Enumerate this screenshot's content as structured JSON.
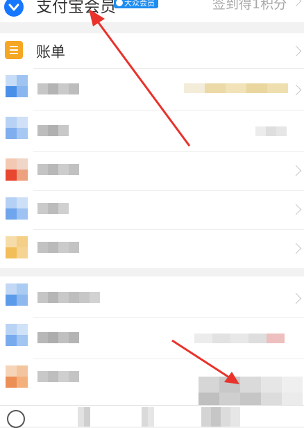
{
  "header": {
    "title": "支付宝会员",
    "badge": "大众会员",
    "checkin": "签到得1积分"
  },
  "menu": {
    "bill_label": "账单"
  },
  "colors": {
    "alipay_blue": "#1677ff",
    "bill_icon": "#f5a623",
    "arrow_red": "#e8322b"
  },
  "icons": {
    "member": "alipay-member-icon",
    "bill": "bill-icon",
    "chevron": "chevron-right-icon"
  }
}
